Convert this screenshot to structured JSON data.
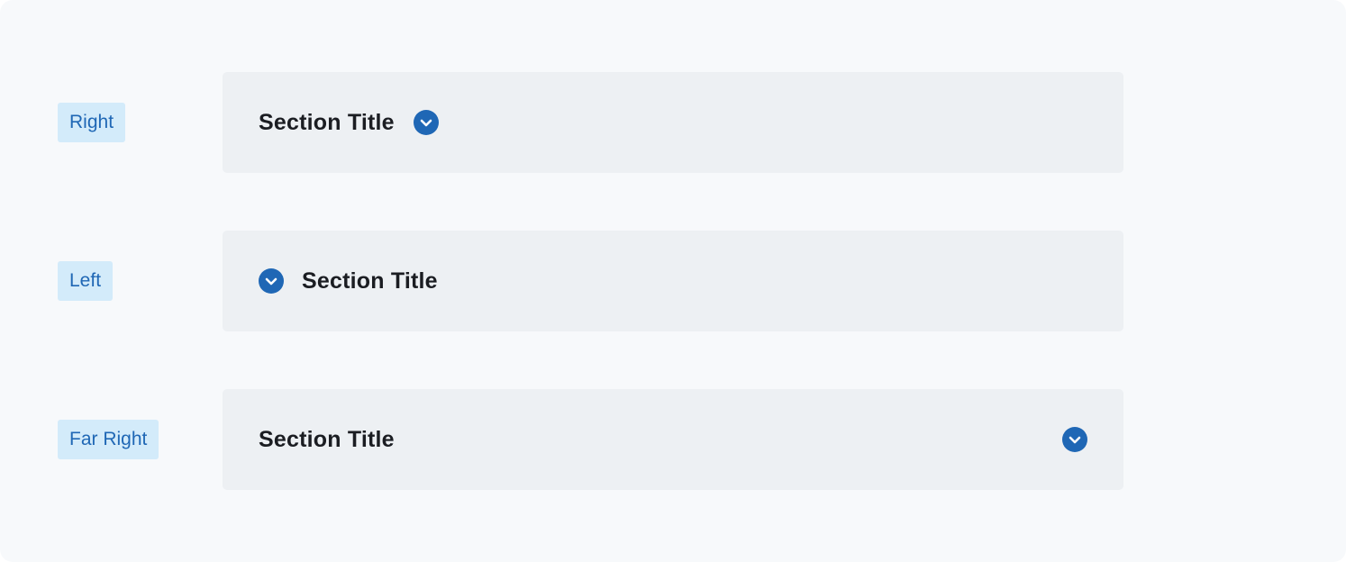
{
  "variants": [
    {
      "tag": "Right",
      "title": "Section Title",
      "icon_position": "right",
      "icon": "chevron-down-circle-icon"
    },
    {
      "tag": "Left",
      "title": "Section Title",
      "icon_position": "left",
      "icon": "chevron-down-circle-icon"
    },
    {
      "tag": "Far Right",
      "title": "Section Title",
      "icon_position": "far-right",
      "icon": "chevron-down-circle-icon"
    }
  ],
  "colors": {
    "background": "#f7f9fb",
    "accordion_bg": "#edf0f3",
    "tag_bg": "#d3ebfa",
    "tag_text": "#1f67b5",
    "icon": "#1f67b5",
    "title_text": "#1b1d22"
  }
}
